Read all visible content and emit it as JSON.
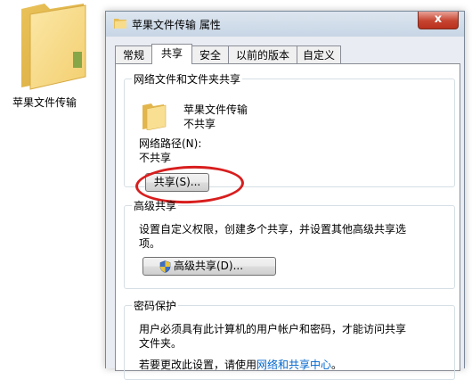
{
  "desktop": {
    "folder_label": "苹果文件传输"
  },
  "window": {
    "title": "苹果文件传输 属性",
    "close_label": "x",
    "tabs": [
      {
        "label": "常规"
      },
      {
        "label": "共享"
      },
      {
        "label": "安全"
      },
      {
        "label": "以前的版本"
      },
      {
        "label": "自定义"
      }
    ],
    "active_tab": "共享"
  },
  "sharing": {
    "group_title": "网络文件和文件夹共享",
    "folder_name": "苹果文件传输",
    "folder_status": "不共享",
    "network_path_label": "网络路径(N):",
    "network_path_value": "不共享",
    "share_button": "共享(S)..."
  },
  "advanced": {
    "group_title": "高级共享",
    "description_line1": "设置自定义权限，创建多个共享，并设置其他高级共享选",
    "description_line2": "项。",
    "button": "高级共享(D)..."
  },
  "password": {
    "group_title": "密码保护",
    "line1": "用户必须具有此计算机的用户帐户和密码，才能访问共享",
    "line2": "文件夹。",
    "line3_prefix": "若要更改此设置，请使用",
    "line3_link": "网络和共享中心",
    "line3_suffix": "。"
  },
  "colors": {
    "accent_link": "#0066cc",
    "annotation_red": "#d81e1e",
    "folder_yellow": "#f4d27a"
  }
}
